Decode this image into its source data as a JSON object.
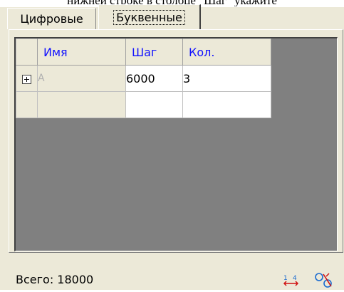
{
  "header": {
    "cropped_text": "нижней строке в столбце \"Шаг\" укажите"
  },
  "tabs": [
    {
      "label": "Цифровые",
      "active": false
    },
    {
      "label": "Буквенные",
      "active": true
    }
  ],
  "grid": {
    "columns": [
      "Имя",
      "Шаг",
      "Кол."
    ],
    "rows": [
      {
        "expandable": true,
        "name": "А",
        "step": "6000",
        "count": "3"
      },
      {
        "expandable": false,
        "name": "",
        "step": "",
        "count": ""
      }
    ]
  },
  "footer": {
    "total_label": "Всего:",
    "total_value": "18000"
  },
  "icons": {
    "sort": "sort-arrows-icon",
    "settings": "tool-settings-icon"
  },
  "colors": {
    "header_text": "#1010ff",
    "panel_bg": "#ece9d8",
    "grid_bg": "#808080",
    "icon_red": "#d01010",
    "icon_blue": "#1a6bd0"
  }
}
